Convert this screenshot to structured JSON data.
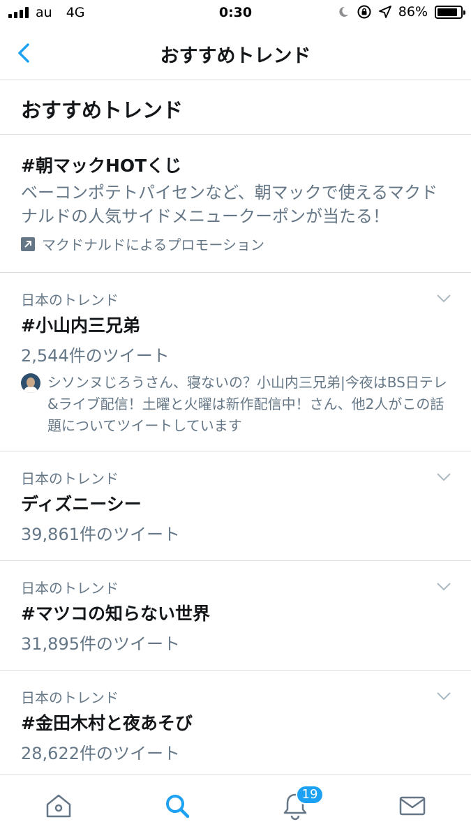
{
  "status_bar": {
    "carrier": "au",
    "network": "4G",
    "time": "0:30",
    "battery_percent": "86%",
    "battery_level": 0.86
  },
  "nav": {
    "title": "おすすめトレンド",
    "back_icon": "chevron-left-icon"
  },
  "section": {
    "header": "おすすめトレンド"
  },
  "promoted": {
    "title": "#朝マックHOTくじ",
    "description": "ベーコンポテトパイセンなど、朝マックで使えるマクドナルドの人気サイドメニュークーポンが当たる！",
    "promoted_by": "マクドナルドによるプロモーション",
    "icon": "promoted-arrow-icon"
  },
  "trends": [
    {
      "meta": "日本のトレンド",
      "name": "#小山内三兄弟",
      "count": "2,544件のツイート",
      "context": "シソンヌじろうさん、寝ないの？小山内三兄弟|今夜はBS日テレ&ライブ配信！土曜と火曜は新作配信中！さん、他2人がこの話題についてツイートしています"
    },
    {
      "meta": "日本のトレンド",
      "name": "ディズニーシー",
      "count": "39,861件のツイート"
    },
    {
      "meta": "日本のトレンド",
      "name": "#マツコの知らない世界",
      "count": "31,895件のツイート"
    },
    {
      "meta": "日本のトレンド",
      "name": "#金田木村と夜あそび",
      "count": "28,622件のツイート"
    }
  ],
  "tab_bar": {
    "tabs": [
      "home-icon",
      "search-icon",
      "notifications-icon",
      "messages-icon"
    ],
    "active": "search-icon",
    "notifications_badge": "19"
  },
  "colors": {
    "accent": "#1da1f2",
    "text_primary": "#14171a",
    "text_secondary": "#657786",
    "divider": "#dcdfe2"
  }
}
